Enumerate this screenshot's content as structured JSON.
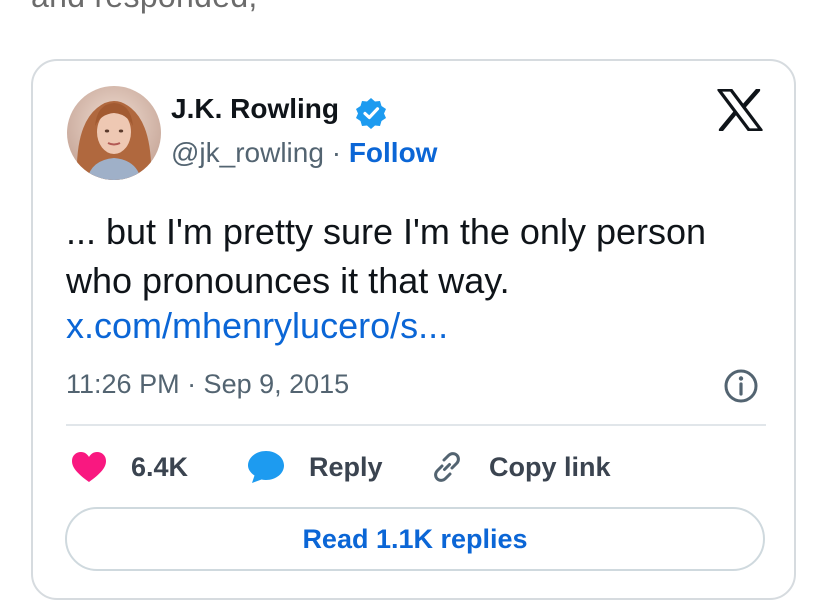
{
  "context": {
    "text": "and responded,"
  },
  "tweet": {
    "author_name": "J.K. Rowling",
    "author_handle": "@jk_rowling",
    "separator": "·",
    "follow_label": "Follow",
    "text": "... but I'm pretty sure I'm the only person who pronounces it that way.",
    "link": "x.com/mhenrylucero/s...",
    "timestamp": "11:26 PM · Sep 9, 2015",
    "likes_count": "6.4K",
    "reply_label": "Reply",
    "copy_link_label": "Copy link",
    "read_replies_label": "Read 1.1K replies"
  },
  "icons": {
    "verified": "verified-badge-icon",
    "x_logo": "x-logo-icon",
    "info": "info-icon",
    "heart": "heart-icon",
    "reply": "speech-bubble-icon",
    "link": "link-icon"
  },
  "colors": {
    "accent": "#0b66d6",
    "heart": "#f91880",
    "reply_bubble": "#1d9bf0",
    "verified": "#1d9bf0",
    "muted_text": "#536471",
    "border": "#d6dbdf"
  }
}
